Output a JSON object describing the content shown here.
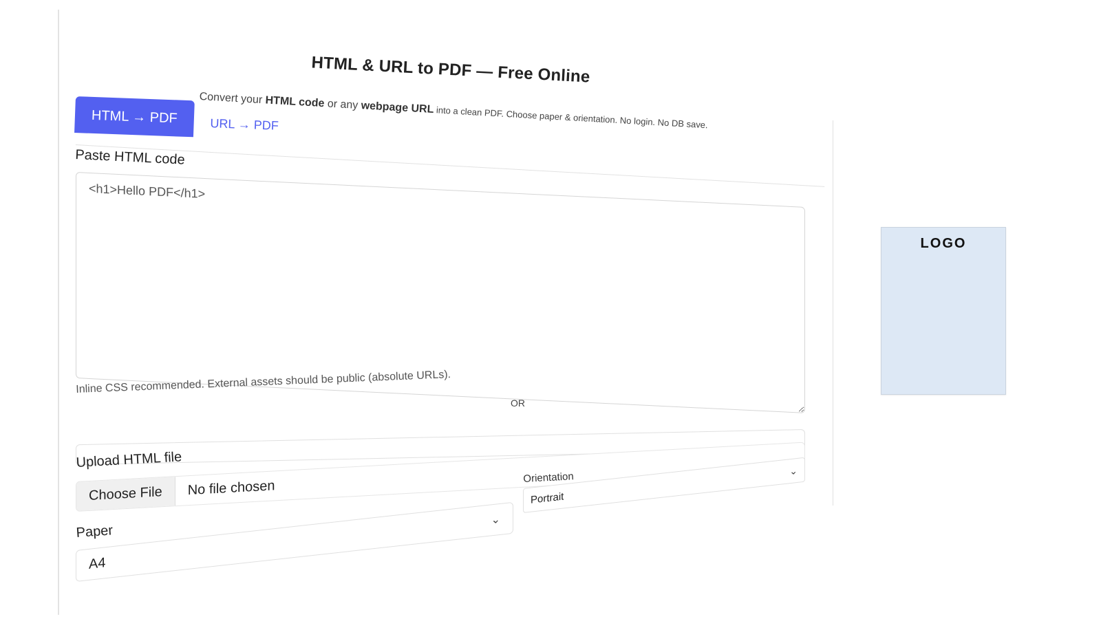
{
  "header": {
    "title": "HTML & URL to PDF — Free Online",
    "subtitle_parts": {
      "p1": "Convert your ",
      "b1": "HTML code",
      "p2": " or any ",
      "b2": "webpage URL",
      "p3": " into a clean PDF. Choose paper & orientation.",
      "p4": " No login. No DB save."
    }
  },
  "tabs": [
    {
      "label": "HTML → PDF",
      "active": true
    },
    {
      "label": "URL → PDF",
      "active": false
    }
  ],
  "form": {
    "paste_label": "Paste HTML code",
    "html_value": "<h1>Hello PDF</h1>",
    "hint": "Inline CSS recommended. External assets should be public (absolute URLs).",
    "or_text": "OR",
    "upload_label": "Upload HTML file",
    "choose_file_label": "Choose File",
    "no_file_text": "No file chosen",
    "orientation_label": "Orientation",
    "orientation_value": "Portrait",
    "paper_label": "Paper",
    "paper_value": "A4"
  },
  "sidebar": {
    "logo_text": "LOGO"
  },
  "colors": {
    "accent": "#5360f0",
    "logo_bg": "#dde8f5"
  },
  "icons": {
    "select_chevron": "chevron-down-icon"
  }
}
